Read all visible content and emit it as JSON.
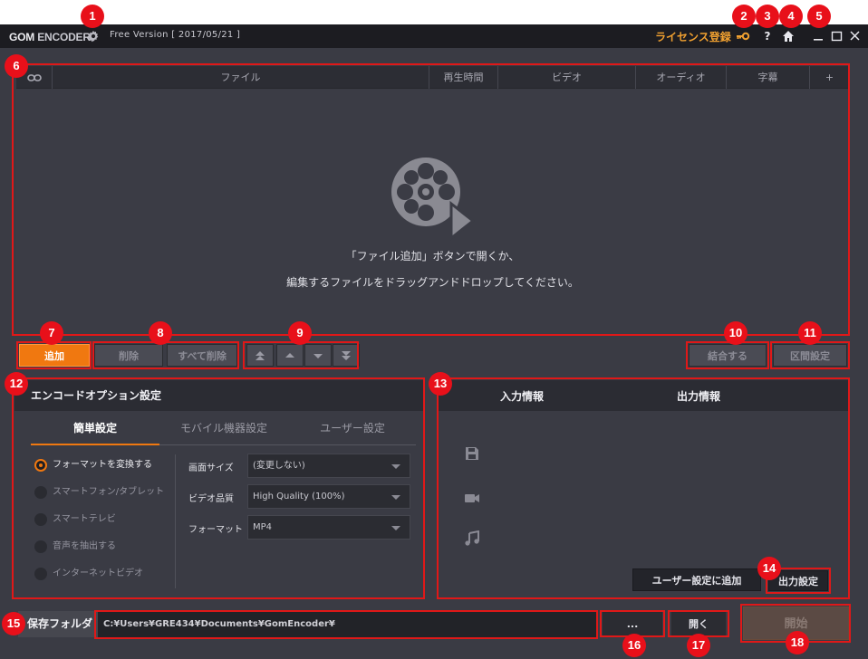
{
  "titlebar": {
    "logo_gom": "GOM",
    "logo_encoder": "ENCODER",
    "version": "Free Version  [ 2017/05/21 ]",
    "license": "ライセンス登録",
    "help": "?"
  },
  "filelist": {
    "columns": [
      "ファイル",
      "再生時間",
      "ビデオ",
      "オーディオ",
      "字幕",
      "+"
    ],
    "empty_line1": "「ファイル追加」ボタンで開くか、",
    "empty_line2": "編集するファイルをドラッグアンドドロップしてください。"
  },
  "buttons": {
    "add": "追加",
    "delete": "削除",
    "delete_all": "すべて削除",
    "move_top": "⏫",
    "move_up": "▲",
    "move_down": "▼",
    "move_bottom": "⏬",
    "merge": "結合する",
    "range": "区間設定"
  },
  "encode": {
    "title": "エンコードオプション設定",
    "tabs": [
      "簡単設定",
      "モバイル機器設定",
      "ユーザー設定"
    ],
    "radios": [
      "フォーマットを変換する",
      "スマートフォン/タブレット",
      "スマートテレビ",
      "音声を抽出する",
      "インターネットビデオ"
    ],
    "fields": [
      {
        "label": "画面サイズ",
        "value": "(変更しない)"
      },
      {
        "label": "ビデオ品質",
        "value": "High Quality (100%)"
      },
      {
        "label": "フォーマット",
        "value": "MP4"
      }
    ]
  },
  "info": {
    "input": "入力情報",
    "output": "出力情報",
    "add_user": "ユーザー設定に追加",
    "output_settings": "出力設定"
  },
  "bottom": {
    "save_label": "保存フォルダ",
    "save_path": "C:¥Users¥GRE434¥Documents¥GomEncoder¥",
    "browse": "...",
    "open": "開く",
    "start": "開始"
  },
  "markers": [
    "1",
    "2",
    "3",
    "4",
    "5",
    "6",
    "7",
    "8",
    "9",
    "10",
    "11",
    "12",
    "13",
    "14",
    "15",
    "16",
    "17",
    "18"
  ],
  "colors": {
    "accent": "#f07810",
    "callout": "#e8101a",
    "license": "#f0a030"
  }
}
